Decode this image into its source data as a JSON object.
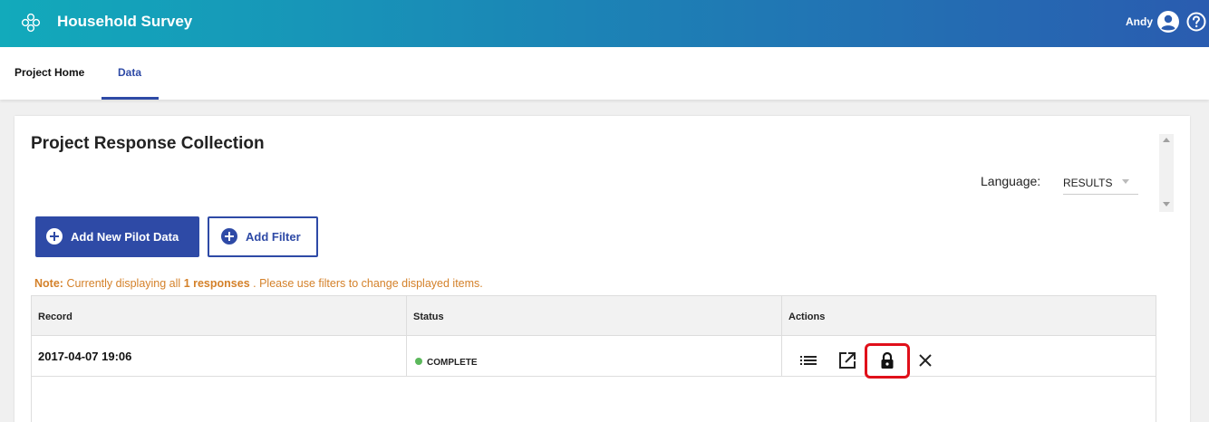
{
  "app": {
    "title": "Household Survey",
    "user_name": "Andy",
    "icons": {
      "logo": "flower-logo-icon",
      "user": "account-circle-icon",
      "help": "help-circle-icon"
    }
  },
  "tabs": [
    {
      "label": "Project Home",
      "active": false
    },
    {
      "label": "Data",
      "active": true
    }
  ],
  "page": {
    "title": "Project Response Collection",
    "language_label": "Language:",
    "language_value": "RESULTS"
  },
  "buttons": {
    "add_pilot": "Add New Pilot Data",
    "add_filter": "Add Filter"
  },
  "note": {
    "prefix": "Note:",
    "text_before": "Currently displaying all",
    "count": "1 responses",
    "text_after": ". Please use filters to change displayed items."
  },
  "table": {
    "headers": [
      "Record",
      "Status",
      "Actions"
    ],
    "rows": [
      {
        "record": "2017-04-07 19:06",
        "status": "COMPLETE",
        "status_color": "#5cb85c",
        "actions": [
          "list-icon",
          "open-in-new-icon",
          "lock-icon",
          "close-icon"
        ]
      }
    ]
  },
  "colors": {
    "accent": "#2e4aa6",
    "note": "#d4812a",
    "highlight": "#e0101a"
  }
}
